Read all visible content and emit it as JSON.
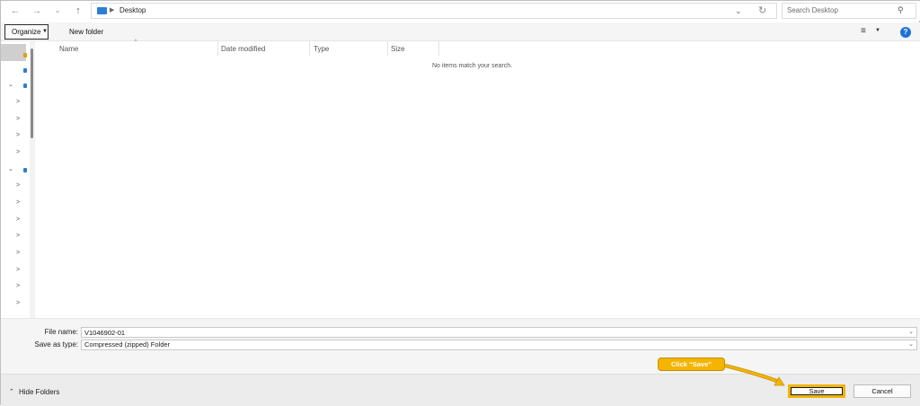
{
  "address": {
    "location": "Desktop",
    "search_placeholder": "Search Desktop"
  },
  "toolbar": {
    "organize_label": "Organize",
    "new_folder_label": "New folder"
  },
  "columns": [
    "Name",
    "Date modified",
    "Type",
    "Size"
  ],
  "empty_message": "No items match your search.",
  "form": {
    "file_name_label": "File name:",
    "file_name_value": "V1046902-01",
    "save_type_label": "Save as type:",
    "save_type_value": "Compressed (zipped) Folder"
  },
  "footer": {
    "hide_folders_label": "Hide Folders",
    "save_label": "Save",
    "cancel_label": "Cancel"
  },
  "annotation": {
    "callout_text": "Click “Save”"
  },
  "colors": {
    "accent": "#1f74d1",
    "callout": "#f4b400"
  }
}
